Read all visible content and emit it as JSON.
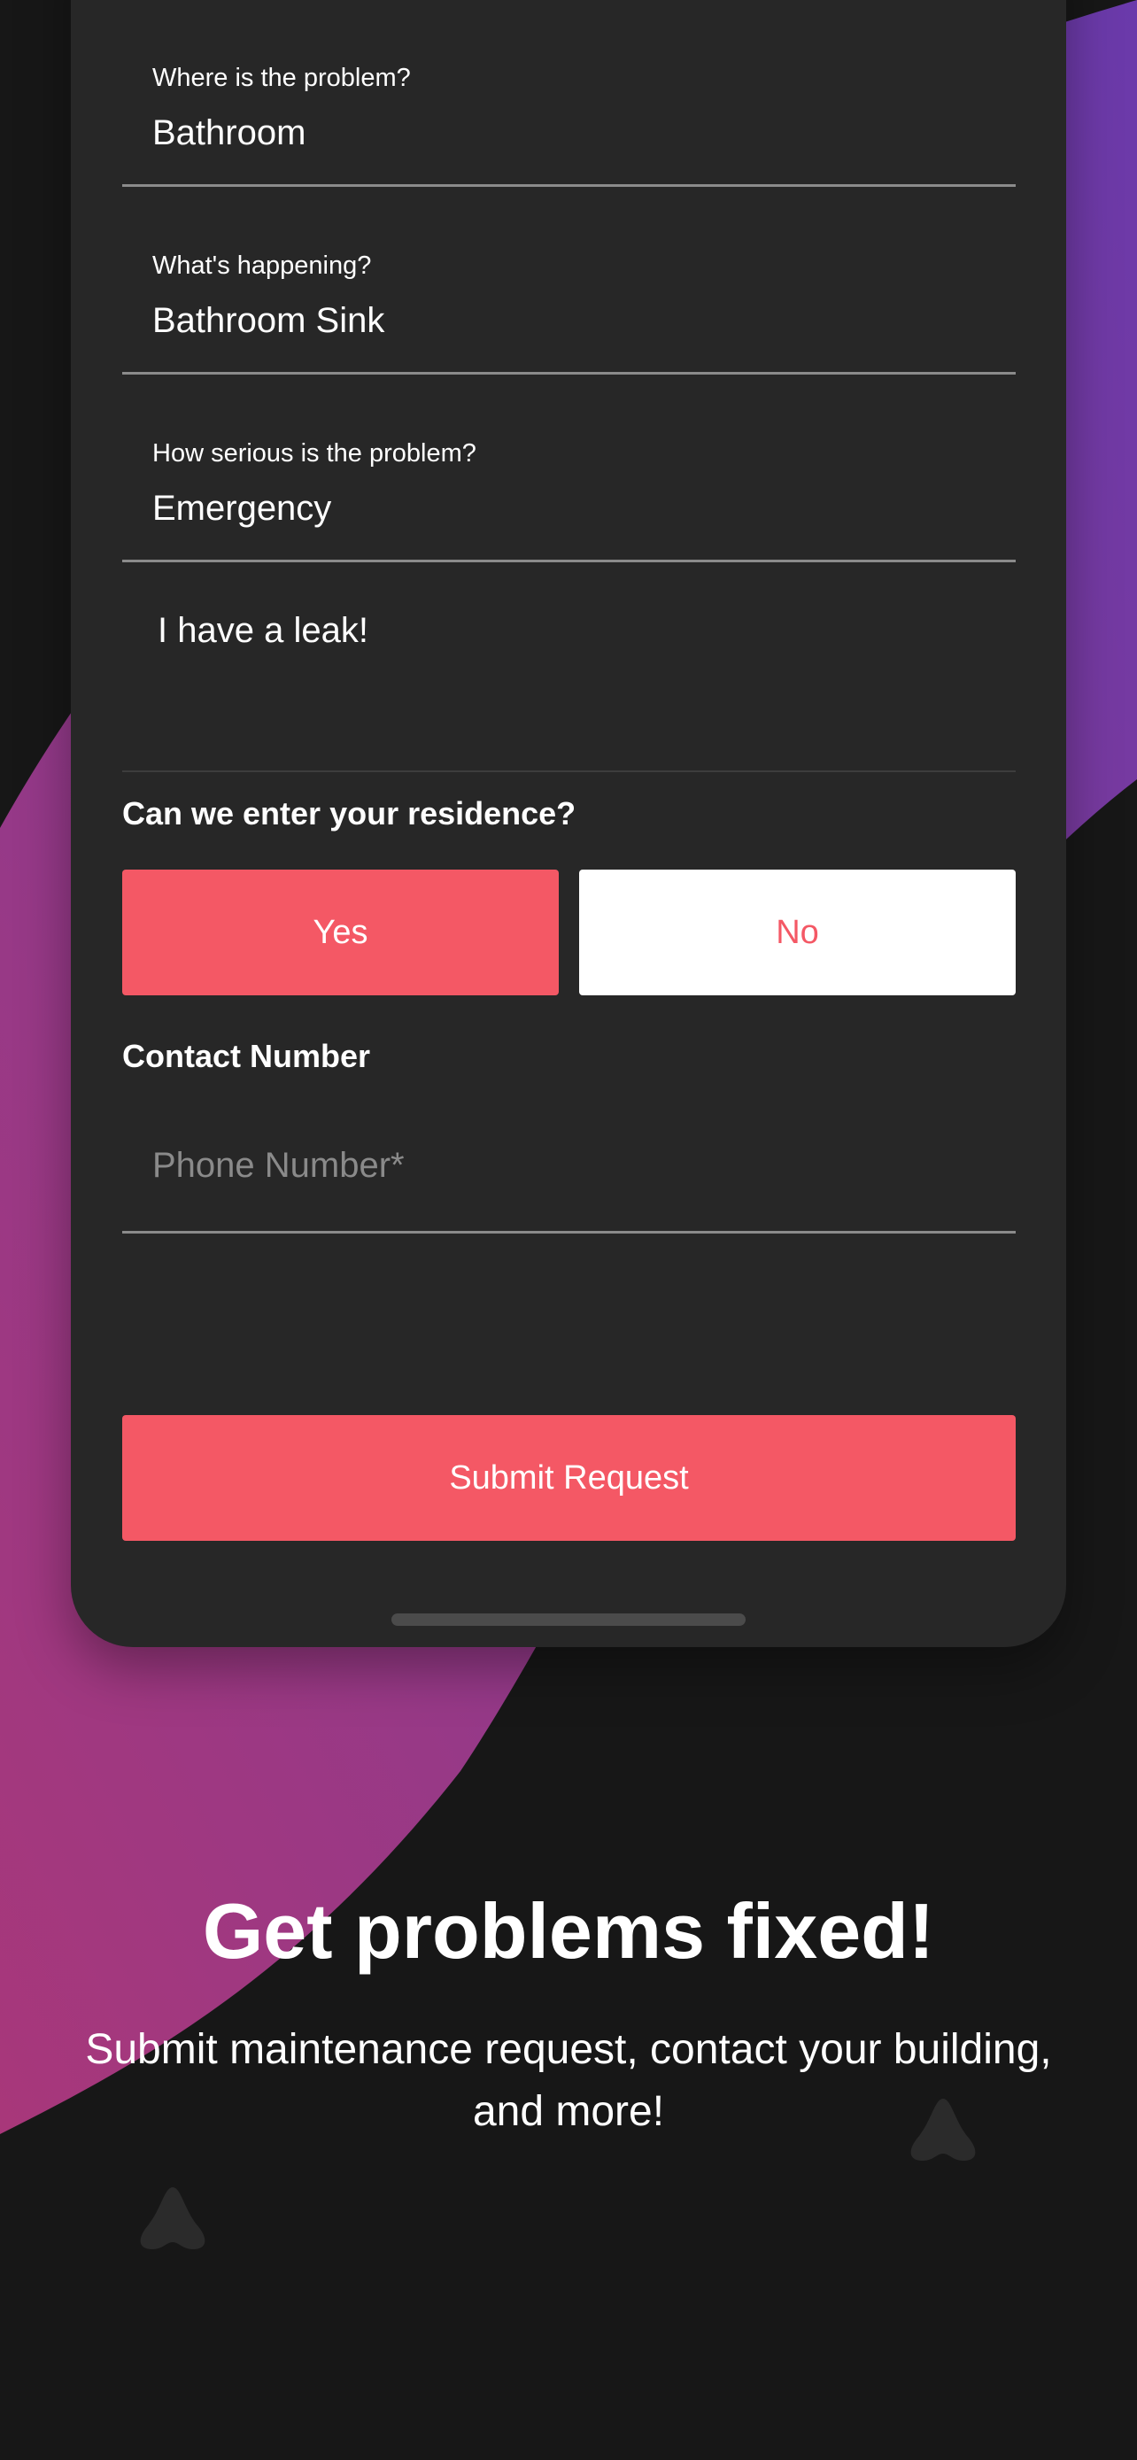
{
  "form": {
    "location": {
      "label": "Where is the problem?",
      "value": "Bathroom"
    },
    "issue": {
      "label": "What's happening?",
      "value": "Bathroom Sink"
    },
    "severity": {
      "label": "How serious is the problem?",
      "value": "Emergency"
    },
    "description": "I have a leak!",
    "entry": {
      "question": "Can we enter your residence?",
      "yes_label": "Yes",
      "no_label": "No",
      "selected": "Yes"
    },
    "contact": {
      "title": "Contact Number",
      "phone_placeholder": "Phone Number*",
      "phone_value": ""
    },
    "submit_label": "Submit Request"
  },
  "promo": {
    "headline": "Get problems fixed!",
    "subtitle": "Submit maintenance request, contact your building, and more!"
  },
  "colors": {
    "accent": "#f45865",
    "card": "#272727",
    "background": "#171717",
    "gradient_top": "#6d3aa8",
    "gradient_bottom": "#a8377a"
  },
  "icons": [
    "home-indicator",
    "decorative-triangle-icon"
  ]
}
